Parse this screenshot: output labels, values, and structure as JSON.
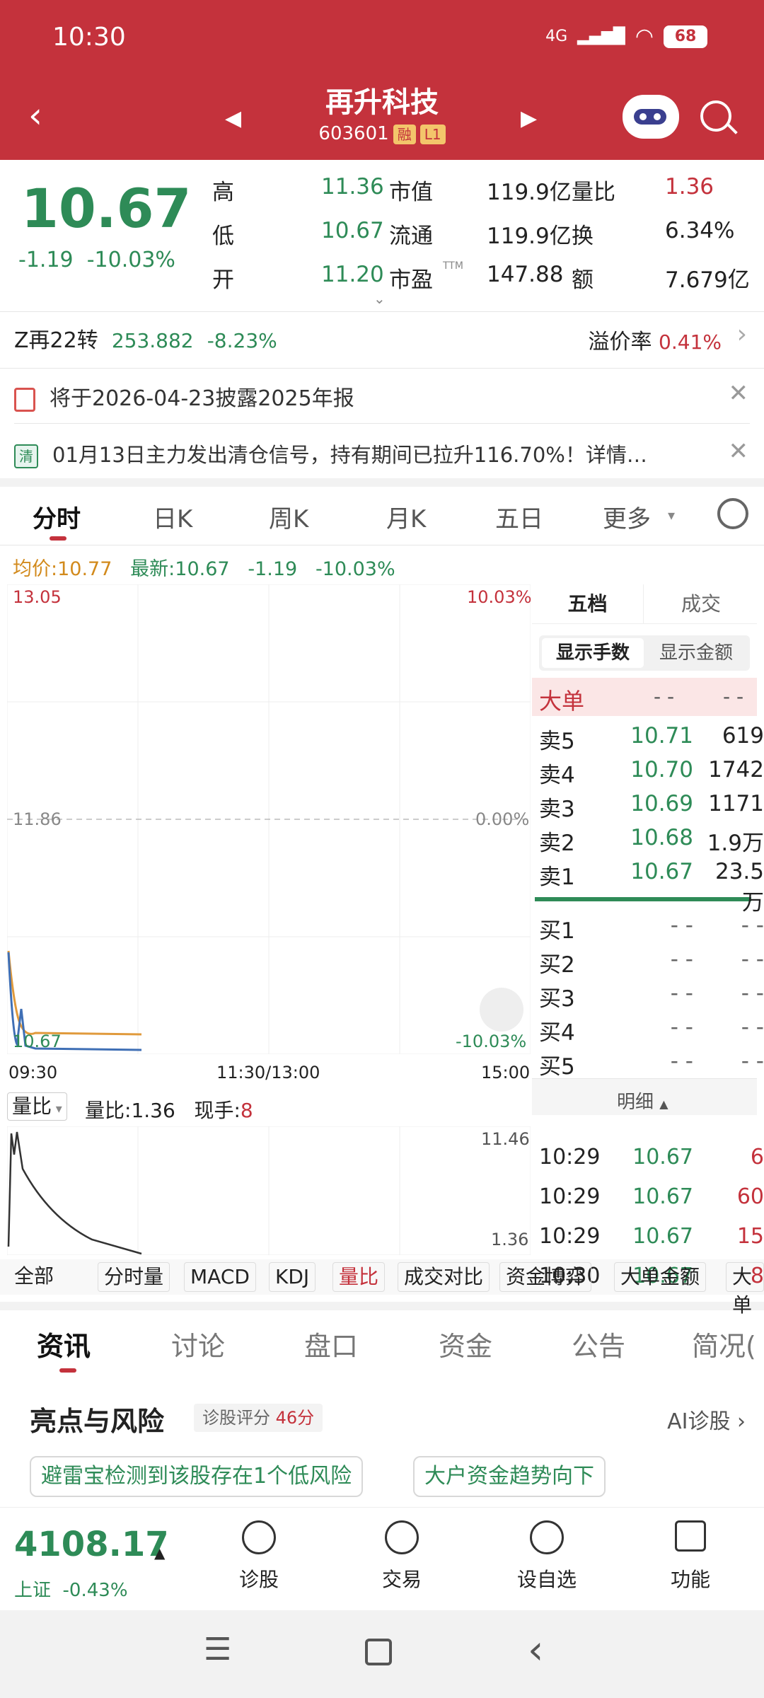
{
  "status": {
    "time": "10:30",
    "net": "4G",
    "battery": "68"
  },
  "header": {
    "title": "再升科技",
    "code": "603601",
    "tag1": "融",
    "tag2": "L1"
  },
  "quote": {
    "price": "10.67",
    "change": "-1.19",
    "pct": "-10.03%",
    "rows": [
      {
        "l1": "高",
        "v1": "11.36",
        "l2": "市值",
        "v2": "119.9亿",
        "l3": "量比",
        "v3": "1.36"
      },
      {
        "l1": "低",
        "v1": "10.67",
        "l2": "流通",
        "v2": "119.9亿",
        "l3": "换",
        "v3": "6.34%"
      },
      {
        "l1": "开",
        "v1": "11.20",
        "l2": "市盈",
        "sup": "TTM",
        "v2": "147.88",
        "l3": "额",
        "v3": "7.679亿"
      }
    ]
  },
  "bond": {
    "name": "Z再22转",
    "price": "253.882",
    "pct": "-8.23%",
    "premium_label": "溢价率",
    "premium": "0.41%"
  },
  "notices": [
    "将于2026-04-23披露2025年报",
    "01月13日主力发出清仓信号，持有期间已拉升116.70%！详情…"
  ],
  "notice_badge": "清",
  "tabs": [
    "分时",
    "日K",
    "周K",
    "月K",
    "五日",
    "更多"
  ],
  "avgline": {
    "avg_label": "均价:",
    "avg": "10.77",
    "latest_label": "最新:",
    "latest": "10.67",
    "chg": "-1.19",
    "pct": "-10.03%"
  },
  "chart": {
    "ymax": "13.05",
    "ymid": "11.86",
    "ymin": "10.67",
    "pmax": "10.03%",
    "pmid": "0.00%",
    "pmin": "-10.03%",
    "t0": "09:30",
    "tmid": "11:30/13:00",
    "t1": "15:00"
  },
  "volume": {
    "sel": "量比",
    "ratio_label": "量比:",
    "ratio": "1.36",
    "hand_label": "现手:",
    "hand": "8",
    "ymax": "11.46",
    "ymin": "1.36"
  },
  "orderbook": {
    "tab1": "五档",
    "tab2": "成交",
    "btn1": "显示手数",
    "btn2": "显示金额",
    "big": "大单",
    "dash": "- -",
    "sells": [
      {
        "n": "卖5",
        "p": "10.71",
        "v": "619"
      },
      {
        "n": "卖4",
        "p": "10.70",
        "v": "1742"
      },
      {
        "n": "卖3",
        "p": "10.69",
        "v": "1171"
      },
      {
        "n": "卖2",
        "p": "10.68",
        "v": "1.9万"
      },
      {
        "n": "卖1",
        "p": "10.67",
        "v": "23.5万"
      }
    ],
    "buys": [
      {
        "n": "买1"
      },
      {
        "n": "买2"
      },
      {
        "n": "买3"
      },
      {
        "n": "买4"
      },
      {
        "n": "买5"
      }
    ],
    "detail": "明细",
    "ticks": [
      {
        "t": "10:29",
        "p": "10.67",
        "v": "6"
      },
      {
        "t": "10:29",
        "p": "10.67",
        "v": "60"
      },
      {
        "t": "10:29",
        "p": "10.67",
        "v": "15"
      },
      {
        "t": "10:30",
        "p": "10.67",
        "v": "8"
      }
    ]
  },
  "indicators": [
    "全部",
    "分时量",
    "MACD",
    "KDJ",
    "量比",
    "成交对比",
    "资金博弈",
    "大单金额",
    "大单"
  ],
  "newstabs": [
    "资讯",
    "讨论",
    "盘口",
    "资金",
    "公告",
    "简况("
  ],
  "risk": {
    "title": "亮点与风险",
    "score_label": "诊股评分",
    "score": "46分",
    "ai": "AI诊股",
    "pill1": "避雷宝检测到该股存在1个低风险",
    "pill2": "大户资金趋势向下"
  },
  "footer": {
    "index": "4108.17",
    "market": "上证",
    "pct": "-0.43%",
    "b1": "诊股",
    "b2": "交易",
    "b3": "设自选",
    "b4": "功能"
  },
  "colors": {
    "header": "#c4323c",
    "down": "#2e8b57",
    "up": "#c4323c",
    "avg": "#d28a1c"
  }
}
